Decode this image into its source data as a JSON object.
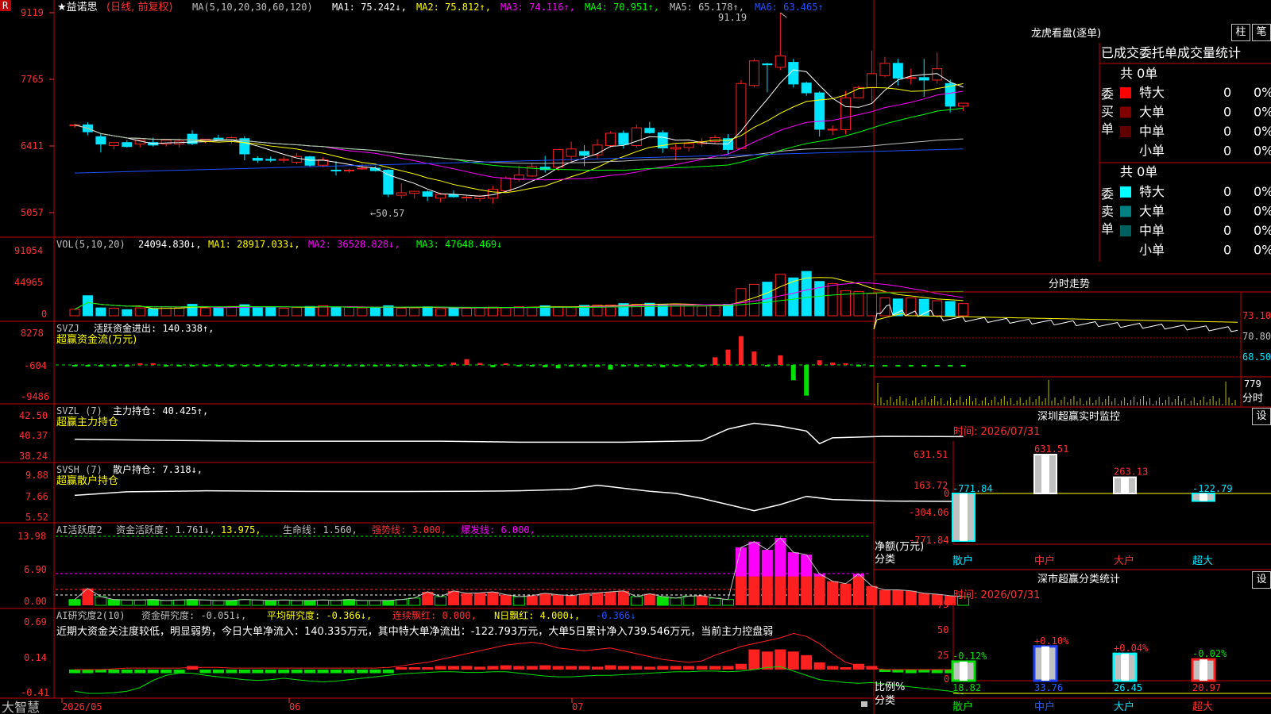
{
  "colors": {
    "up": "#ff2020",
    "down": "#00e5ff",
    "frame": "#c00000",
    "ma1": "#ffffff",
    "ma2": "#ffff00",
    "ma3": "#ff00ff",
    "ma4": "#00ff00",
    "ma5": "#c0c0c0",
    "ma6": "#2050ff",
    "green": "#00e000",
    "yellow": "#ffff00",
    "magenta": "#ff00ff"
  },
  "kline": {
    "flag": "R",
    "name": "★益诺思",
    "period": "(日线, 前复权)",
    "ma_label": "MA(5,10,20,30,60,120)",
    "ma": [
      {
        "label": "MA1: 75.242↓,",
        "color": "#ffffff"
      },
      {
        "label": "MA2: 75.812↑,",
        "color": "#ffff00"
      },
      {
        "label": "MA3: 74.116↑,",
        "color": "#ff00ff"
      },
      {
        "label": "MA4: 70.951↑,",
        "color": "#00ff00"
      },
      {
        "label": "MA5: 65.178↑,",
        "color": "#c0c0c0"
      },
      {
        "label": "MA6: 63.465↑",
        "color": "#2050ff"
      }
    ],
    "yticks": [
      "9119",
      "7765",
      "6411",
      "5057"
    ],
    "high_mark": "91.19",
    "low_mark": "←50.57"
  },
  "vol": {
    "label": "VOL(5,10,20)",
    "value": "24094.830↓,",
    "ma": [
      {
        "label": "MA1: 28917.033↓,",
        "color": "#ffff00"
      },
      {
        "label": "MA2: 36528.828↓,",
        "color": "#ff00ff"
      },
      {
        "label": "MA3: 47648.469↓",
        "color": "#00ff00"
      }
    ],
    "yticks": [
      "91054",
      "44965",
      "0"
    ]
  },
  "svzj": {
    "label": "SVZJ",
    "desc": "活跃资金进出: 140.338↑,",
    "sub": "超赢资金流(万元)",
    "yticks": [
      "8278",
      "-604",
      "-9486"
    ]
  },
  "svzl": {
    "label": "SVZL (7)",
    "desc": "主力持仓: 40.425↑,",
    "sub": "超赢主力持仓",
    "yticks": [
      "42.50",
      "40.37",
      "38.24"
    ]
  },
  "svsh": {
    "label": "SVSH (7)",
    "desc": "散户持仓: 7.318↓,",
    "sub": "超赢散户持仓",
    "yticks": [
      "9.88",
      "7.66",
      "5.52"
    ]
  },
  "ai1": {
    "label": "AI活跃度2",
    "items": [
      {
        "text": "资金活跃度: 1.761↓,",
        "color": "#c0c0c0"
      },
      {
        "text": "13.975,",
        "color": "#ffff00"
      },
      {
        "text": "生命线: 1.560,",
        "color": "#c0c0c0"
      },
      {
        "text": "强势线: 3.000,",
        "color": "#ff3030"
      },
      {
        "text": "爆发线: 6.000,",
        "color": "#ff00ff"
      }
    ],
    "yticks": [
      "13.98",
      "6.90",
      "0.00"
    ]
  },
  "ai2": {
    "label": "AI研究度2(10)",
    "items": [
      {
        "text": "资金研究度: -0.051↓,",
        "color": "#c0c0c0"
      },
      {
        "text": "平均研究度: -0.366↓,",
        "color": "#ffff00"
      },
      {
        "text": "连续飘红: 0.000,",
        "color": "#ff3030"
      },
      {
        "text": "N日飘红: 4.000↓,",
        "color": "#ffff00"
      },
      {
        "text": "-0.366↓",
        "color": "#2050ff"
      }
    ],
    "comment": "近期大资金关注度较低，明显弱势，今日大单净流入：140.335万元，其中特大单净流出：-122.793万元，大单5日累计净入739.546万元，当前主力控盘弱",
    "yticks": [
      "0.69",
      "0.14",
      "-0.41"
    ]
  },
  "xaxis": {
    "app": "大智慧",
    "labels": [
      "2026/05",
      "06",
      "07"
    ]
  },
  "right": {
    "title": "龙虎看盘(逐单)",
    "btn1": "柱",
    "btn2": "笔",
    "tabs": "已成交委托单成交量统计",
    "buy": {
      "side": "委买单",
      "total": "共 0单",
      "rows": [
        {
          "label": "特大",
          "count": "0",
          "pct": "0%",
          "color": "#ff0000"
        },
        {
          "label": "大单",
          "count": "0",
          "pct": "0%",
          "color": "#800000"
        },
        {
          "label": "中单",
          "count": "0",
          "pct": "0%",
          "color": "#600000"
        },
        {
          "label": "小单",
          "count": "0",
          "pct": "0%",
          "color": "#000000"
        }
      ]
    },
    "sell": {
      "side": "委卖单",
      "total": "共 0单",
      "rows": [
        {
          "label": "特大",
          "count": "0",
          "pct": "0%",
          "color": "#00ffff"
        },
        {
          "label": "大单",
          "count": "0",
          "pct": "0%",
          "color": "#008080"
        },
        {
          "label": "中单",
          "count": "0",
          "pct": "0%",
          "color": "#006060"
        },
        {
          "label": "小单",
          "count": "0",
          "pct": "0%",
          "color": "#000000"
        }
      ]
    },
    "intraday": {
      "title": "分时走势",
      "yticks": [
        "73.10",
        "70.80",
        "68.50"
      ],
      "vol_label": "779",
      "time_label": "分时"
    },
    "monitor": {
      "title": "深圳超赢实时监控",
      "btn": "设",
      "time": "时间: 2026/07/31",
      "yticks": [
        "631.51",
        "163.72",
        "0",
        "-304.06",
        "-771.84"
      ],
      "ylabel": "净额(万元)",
      "xlabel": "分类",
      "categories": [
        "散户",
        "中户",
        "大户",
        "超大"
      ],
      "values": [
        "-771.84",
        "631.51",
        "263.13",
        "-122.79"
      ]
    },
    "stats": {
      "title": "深市超赢分类统计",
      "btn": "设",
      "time": "时间: 2026/07/31",
      "yticks": [
        "75",
        "50",
        "25",
        "0"
      ],
      "ylabel": "比例%",
      "xlabel": "分类",
      "categories": [
        "散户",
        "中户",
        "大户",
        "超大"
      ],
      "values": [
        "18.82",
        "33.76",
        "26.45",
        "20.97"
      ],
      "changes": [
        "-0.12%",
        "+0.10%",
        "+0.04%",
        "-0.02%"
      ]
    }
  },
  "chart_data": [
    {
      "type": "candlestick",
      "title": "★益诺思",
      "ylim": [
        50.57,
        91.19
      ],
      "ohlc": [
        [
          68.2,
          68.6,
          67.8,
          68.4
        ],
        [
          68.4,
          68.9,
          66.3,
          67.0
        ],
        [
          66.0,
          66.7,
          62.8,
          64.5
        ],
        [
          64.2,
          64.8,
          63.4,
          64.8
        ],
        [
          64.8,
          65.3,
          63.8,
          64.0
        ],
        [
          64.5,
          65.4,
          63.8,
          65.3
        ],
        [
          64.8,
          65.8,
          64.0,
          64.3
        ],
        [
          64.5,
          65.5,
          64.0,
          65.3
        ],
        [
          64.5,
          65.6,
          63.8,
          65.1
        ],
        [
          66.5,
          67.3,
          64.3,
          64.6
        ],
        [
          65.1,
          65.5,
          64.7,
          65.5
        ],
        [
          65.7,
          66.4,
          65.4,
          65.5
        ],
        [
          65.3,
          66.0,
          64.6,
          65.8
        ],
        [
          65.6,
          66.1,
          61.2,
          62.5
        ],
        [
          61.6,
          62.0,
          60.7,
          61.2
        ],
        [
          61.4,
          62.0,
          60.8,
          61.2
        ],
        [
          61.2,
          62.0,
          60.7,
          61.4
        ],
        [
          60.8,
          62.7,
          60.4,
          62.0
        ],
        [
          61.9,
          62.1,
          59.8,
          60.2
        ],
        [
          60.2,
          61.8,
          59.8,
          61.3
        ],
        [
          59.2,
          61.0,
          58.1,
          59.1
        ],
        [
          59.1,
          59.5,
          58.6,
          59.2
        ],
        [
          59.5,
          60.5,
          59.3,
          59.6
        ],
        [
          59.6,
          60.0,
          58.9,
          59.1
        ],
        [
          59.2,
          59.4,
          53.7,
          54.3
        ],
        [
          54.1,
          56.5,
          53.5,
          54.6
        ],
        [
          54.5,
          55.0,
          53.4,
          54.9
        ],
        [
          54.8,
          55.1,
          52.9,
          53.9
        ],
        [
          53.5,
          54.6,
          52.6,
          54.3
        ],
        [
          54.2,
          55.1,
          53.6,
          53.8
        ],
        [
          53.6,
          54.0,
          52.9,
          53.7
        ],
        [
          53.4,
          54.2,
          52.8,
          53.9
        ],
        [
          53.5,
          56.0,
          52.4,
          55.3
        ],
        [
          55.0,
          57.9,
          54.8,
          57.6
        ],
        [
          57.3,
          60.1,
          56.9,
          58.2
        ],
        [
          58.0,
          60.5,
          57.8,
          59.9
        ],
        [
          59.8,
          62.1,
          58.7,
          59.3
        ],
        [
          59.8,
          63.0,
          59.1,
          63.4
        ],
        [
          62.0,
          65.0,
          61.0,
          63.5
        ],
        [
          63.0,
          64.3,
          60.0,
          62.2
        ],
        [
          62.3,
          65.5,
          61.4,
          64.3
        ],
        [
          64.2,
          67.1,
          63.8,
          66.7
        ],
        [
          66.7,
          67.3,
          63.6,
          64.4
        ],
        [
          64.2,
          68.5,
          63.8,
          67.8
        ],
        [
          67.7,
          69.0,
          66.6,
          66.8
        ],
        [
          66.8,
          67.3,
          62.7,
          63.7
        ],
        [
          63.5,
          64.5,
          61.2,
          63.8
        ],
        [
          63.8,
          65.0,
          63.0,
          64.6
        ],
        [
          64.6,
          65.7,
          63.9,
          65.0
        ],
        [
          65.0,
          66.3,
          64.6,
          65.8
        ],
        [
          65.6,
          66.5,
          62.5,
          63.4
        ],
        [
          63.6,
          77.5,
          63.5,
          76.8
        ],
        [
          76.4,
          81.9,
          76.0,
          81.4
        ],
        [
          80.8,
          81.0,
          75.0,
          80.6
        ],
        [
          80.1,
          91.2,
          79.5,
          82.4
        ],
        [
          81.1,
          81.8,
          76.0,
          76.7
        ],
        [
          76.9,
          77.2,
          74.3,
          74.9
        ],
        [
          74.9,
          75.2,
          66.0,
          67.5
        ],
        [
          67.5,
          68.3,
          66.3,
          67.5
        ],
        [
          67.4,
          75.3,
          66.5,
          73.9
        ],
        [
          73.9,
          76.4,
          73.8,
          76.0
        ],
        [
          76.0,
          83.5,
          73.0,
          78.8
        ],
        [
          78.4,
          82.2,
          78.1,
          80.9
        ],
        [
          80.9,
          81.8,
          76.4,
          77.9
        ],
        [
          77.9,
          79.8,
          76.6,
          78.0
        ],
        [
          78.0,
          81.8,
          74.1,
          77.5
        ],
        [
          77.5,
          83.1,
          76.8,
          79.8
        ],
        [
          76.8,
          77.6,
          70.9,
          72.2
        ],
        [
          72.2,
          72.8,
          71.2,
          72.8
        ]
      ],
      "series": [
        {
          "name": "MA1",
          "last": 75.242
        },
        {
          "name": "MA2",
          "last": 75.812
        },
        {
          "name": "MA3",
          "last": 74.116
        },
        {
          "name": "MA4",
          "last": 70.951
        },
        {
          "name": "MA5",
          "last": 65.178
        },
        {
          "name": "MA6",
          "last": 63.465
        }
      ]
    },
    {
      "type": "bar",
      "title": "VOL(5,10,20)",
      "ylim": [
        0,
        91054
      ],
      "values": [
        9000,
        28000,
        11000,
        10500,
        8500,
        11000,
        9800,
        12500,
        11000,
        16000,
        11000,
        11500,
        13000,
        15500,
        11000,
        12000,
        10500,
        11500,
        13000,
        14000,
        12000,
        12000,
        11000,
        11000,
        14000,
        10500,
        11000,
        12500,
        10000,
        10500,
        10500,
        11500,
        12000,
        11500,
        12500,
        12000,
        14000,
        12500,
        11500,
        14500,
        15000,
        15000,
        17000,
        16000,
        17500,
        16000,
        16500,
        15000,
        13500,
        14500,
        16000,
        38000,
        44000,
        47000,
        58000,
        53000,
        62000,
        48000,
        45000,
        35000,
        34000,
        31000,
        25000,
        23500,
        25000,
        23000,
        21000,
        20000,
        17000
      ]
    },
    {
      "type": "bar",
      "title": "超赢资金流(万元)",
      "ylim": [
        -9486,
        8278
      ],
      "values": [
        -300,
        -250,
        -300,
        -200,
        -100,
        150,
        100,
        -200,
        -250,
        -200,
        -200,
        -250,
        -500,
        -200,
        -250,
        -200,
        -300,
        -200,
        -250,
        -200,
        -200,
        -300,
        -200,
        -250,
        -200,
        -300,
        -200,
        -250,
        -300,
        600,
        1500,
        500,
        -600,
        300,
        -250,
        -400,
        -600,
        -900,
        -300,
        -500,
        -500,
        -1200,
        -400,
        -500,
        -300,
        -600,
        -300,
        -500,
        -500,
        2000,
        4000,
        7500,
        3500,
        -400,
        2500,
        -4000,
        -8000,
        1200,
        600,
        200,
        -300,
        -200,
        -300,
        -250,
        -300,
        -200,
        -350,
        -200,
        -250
      ]
    },
    {
      "type": "line",
      "title": "超赢主力持仓",
      "ylim": [
        38.24,
        42.5
      ],
      "x": [
        0,
        6,
        14,
        20,
        28,
        34,
        42,
        48,
        50,
        52,
        54,
        56,
        57,
        58,
        62,
        68
      ],
      "values": [
        40.15,
        40.05,
        39.95,
        39.95,
        39.95,
        39.85,
        39.85,
        40.0,
        41.2,
        41.8,
        41.5,
        41.0,
        39.7,
        40.3,
        40.45,
        40.42
      ]
    },
    {
      "type": "line",
      "title": "超赢散户持仓",
      "ylim": [
        5.52,
        9.88
      ],
      "x": [
        0,
        4,
        10,
        16,
        22,
        30,
        34,
        38,
        40,
        44,
        46,
        48,
        50,
        52,
        54,
        56,
        58,
        62,
        68
      ],
      "values": [
        7.9,
        8.25,
        8.35,
        8.3,
        8.28,
        8.3,
        8.35,
        8.5,
        8.9,
        8.3,
        8.1,
        7.6,
        7.0,
        6.4,
        7.0,
        7.8,
        7.5,
        7.35,
        7.3
      ]
    },
    {
      "type": "bar",
      "title": "AI活跃度2",
      "ylim": [
        0,
        13.98
      ],
      "values": [
        1.2,
        3.5,
        1.8,
        1.2,
        1.1,
        1.1,
        1.2,
        1.0,
        1.1,
        1.2,
        1.1,
        1.0,
        1.0,
        1.2,
        1.1,
        1.0,
        1.1,
        1.0,
        1.0,
        1.1,
        1.0,
        1.2,
        1.0,
        1.0,
        1.0,
        1.2,
        1.5,
        2.8,
        1.8,
        3.0,
        2.5,
        2.6,
        2.8,
        2.2,
        1.8,
        2.0,
        2.5,
        2.2,
        2.0,
        2.4,
        2.6,
        2.8,
        3.0,
        1.8,
        2.4,
        1.8,
        1.5,
        1.9,
        2.0,
        1.5,
        1.2,
        12.0,
        13.2,
        11.5,
        13.98,
        11.0,
        10.5,
        6.5,
        5.0,
        4.5,
        6.5,
        4.0,
        3.2,
        3.2,
        3.0,
        2.5,
        2.3,
        2.0,
        1.8
      ],
      "series": [
        {
          "name": "强势线",
          "value": 3.0
        },
        {
          "name": "爆发线",
          "value": 6.0
        },
        {
          "name": "生命线",
          "value": 1.56
        }
      ]
    },
    {
      "type": "bar",
      "title": "AI研究度2(10)",
      "ylim": [
        -0.41,
        0.69
      ],
      "values": [
        -0.05,
        -0.05,
        -0.04,
        -0.05,
        -0.05,
        -0.05,
        -0.05,
        -0.05,
        -0.05,
        0.05,
        -0.05,
        -0.05,
        -0.05,
        -0.05,
        -0.05,
        -0.05,
        -0.05,
        -0.05,
        -0.05,
        -0.05,
        -0.05,
        -0.05,
        -0.05,
        -0.05,
        -0.05,
        0.02,
        0.02,
        0.03,
        0.05,
        0.05,
        0.05,
        0.04,
        0.05,
        0.06,
        0.05,
        0.05,
        0.06,
        0.05,
        0.05,
        0.05,
        0.04,
        0.06,
        0.05,
        0.05,
        0.04,
        0.05,
        0.05,
        0.05,
        0.05,
        0.05,
        0.05,
        0.08,
        0.28,
        0.25,
        0.28,
        0.25,
        0.2,
        0.1,
        0.05,
        0.03,
        0.08,
        0.05,
        -0.03,
        -0.04,
        -0.05,
        -0.04,
        -0.05,
        -0.05,
        -0.05
      ]
    }
  ]
}
